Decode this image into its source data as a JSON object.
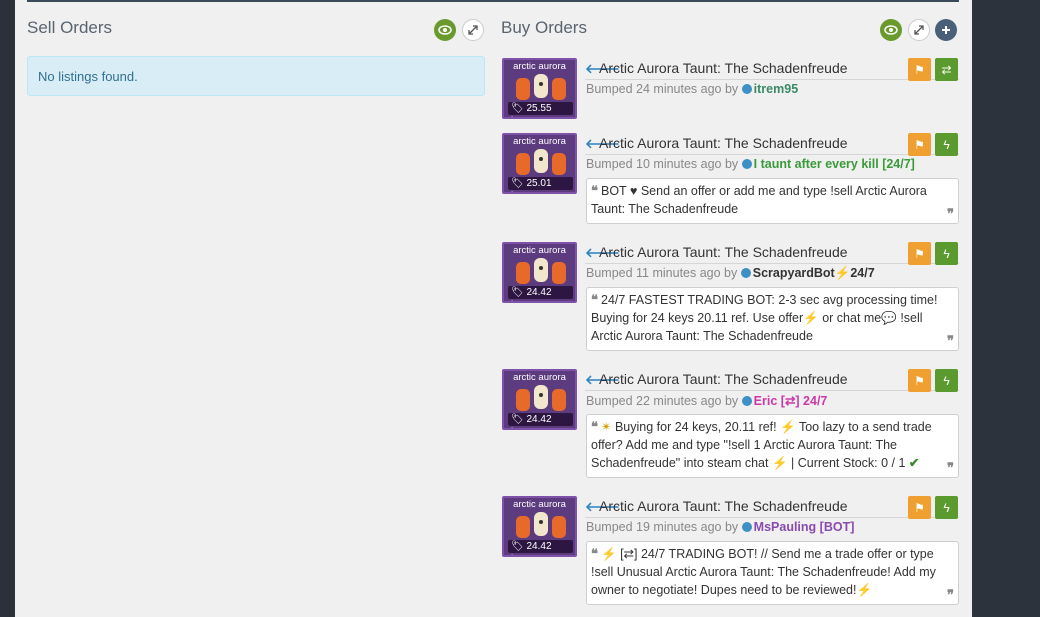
{
  "sell": {
    "title": "Sell Orders",
    "empty_message": "No listings found."
  },
  "buy": {
    "title": "Buy Orders"
  },
  "listings": [
    {
      "thumb_name": "arctic aurora",
      "price": "25.55 keys",
      "item_name": "Arctic Aurora Taunt: The Schadenfreude",
      "bumped": "Bumped 24 minutes ago by",
      "user": "itrem95",
      "user_color": "#3a8a6a",
      "action_icon": "swap-icon"
    },
    {
      "thumb_name": "arctic aurora",
      "price": "25.01 keys",
      "item_name": "Arctic Aurora Taunt: The Schadenfreude",
      "bumped": "Bumped 10 minutes ago by",
      "user": "I taunt after every kill [24/7]",
      "user_color": "#3a9a3a",
      "action_icon": "lightning-icon",
      "comment_text": "BOT ♥ Send an offer or add me and type !sell Arctic Aurora Taunt: The Schadenfreude"
    },
    {
      "thumb_name": "arctic aurora",
      "price": "24.42 keys",
      "item_name": "Arctic Aurora Taunt: The Schadenfreude",
      "bumped": "Bumped 11 minutes ago by",
      "user_a": "ScrapyardBot",
      "user_b": "24/7",
      "user_color": "#333333",
      "action_icon": "lightning-icon",
      "comment_a": "24/7 FASTEST TRADING BOT: 2-3 sec avg processing time! Buying for 24 keys 20.11 ref. Use offer",
      "comment_b": " or chat me",
      "comment_c": " !sell Arctic Aurora Taunt: The Schadenfreude"
    },
    {
      "thumb_name": "arctic aurora",
      "price": "24.42 keys",
      "item_name": "Arctic Aurora Taunt: The Schadenfreude",
      "bumped": "Bumped 22 minutes ago by",
      "user_a": "Eric [",
      "user_b": "] 24/7",
      "user_color": "#c93aa8",
      "action_icon": "lightning-icon",
      "comment_a": "Buying for 24 keys, 20.11 ref!",
      "comment_b": " Too lazy to a send trade offer? Add me and type \"!sell 1 Arctic Aurora Taunt: The Schadenfreude\" into steam chat",
      "comment_c": " | Current Stock: 0 / 1"
    },
    {
      "thumb_name": "arctic aurora",
      "price": "24.42 keys",
      "item_name": "Arctic Aurora Taunt: The Schadenfreude",
      "bumped": "Bumped 19 minutes ago by",
      "user": "MsPauling [BOT]",
      "user_color": "#8a4ab0",
      "action_icon": "lightning-icon",
      "comment_a": "[",
      "comment_b": "] 24/7 TRADING BOT! // Send me a trade offer or type !sell Unusual Arctic Aurora Taunt: The Schadenfreude! Add my owner to negotiate! Dupes need to be reviewed!"
    }
  ],
  "colors": {
    "accent_green": "#5b9a2e",
    "flag_orange": "#f0a030",
    "link_blue": "#2b84c6"
  }
}
